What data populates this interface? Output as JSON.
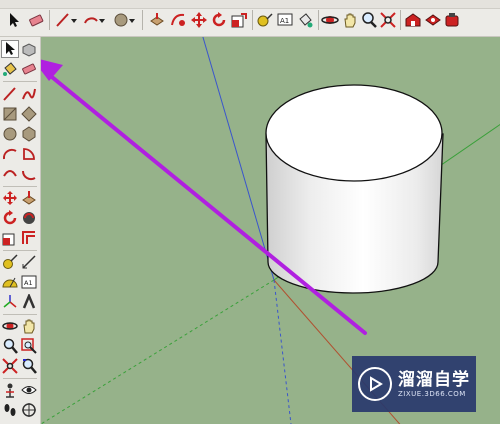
{
  "toolbar": {
    "top_buttons": [
      {
        "icon": "select-arrow-icon"
      },
      {
        "icon": "eraser-icon"
      },
      {
        "icon": "pencil-line-icon"
      },
      {
        "icon": "arc-icon"
      },
      {
        "icon": "rectangle-icon"
      },
      {
        "icon": "circle-icon"
      },
      {
        "icon": "push-pull-icon"
      },
      {
        "icon": "follow-me-icon"
      },
      {
        "icon": "move-icon"
      },
      {
        "icon": "rotate-icon"
      },
      {
        "icon": "scale-icon"
      },
      {
        "icon": "tape-measure-icon"
      },
      {
        "icon": "text-icon"
      },
      {
        "icon": "paint-bucket-icon"
      },
      {
        "icon": "orbit-icon"
      },
      {
        "icon": "pan-icon"
      },
      {
        "icon": "zoom-icon"
      },
      {
        "icon": "zoom-extents-icon"
      },
      {
        "icon": "warehouse-icon"
      },
      {
        "icon": "extension-icon"
      }
    ],
    "text_tool_label": "A1"
  },
  "side_toolbar": {
    "text_tool_label": "A1"
  },
  "viewport": {
    "model": "cylinder",
    "axis_colors": {
      "blue": "#3355cc",
      "green": "#2f9a2f",
      "red": "#b05030"
    },
    "background": "#96b28a",
    "annotation_arrow_color": "#b020e0"
  },
  "watermark": {
    "title": "溜溜自学",
    "url": "ZIXUE.3D66.COM"
  }
}
